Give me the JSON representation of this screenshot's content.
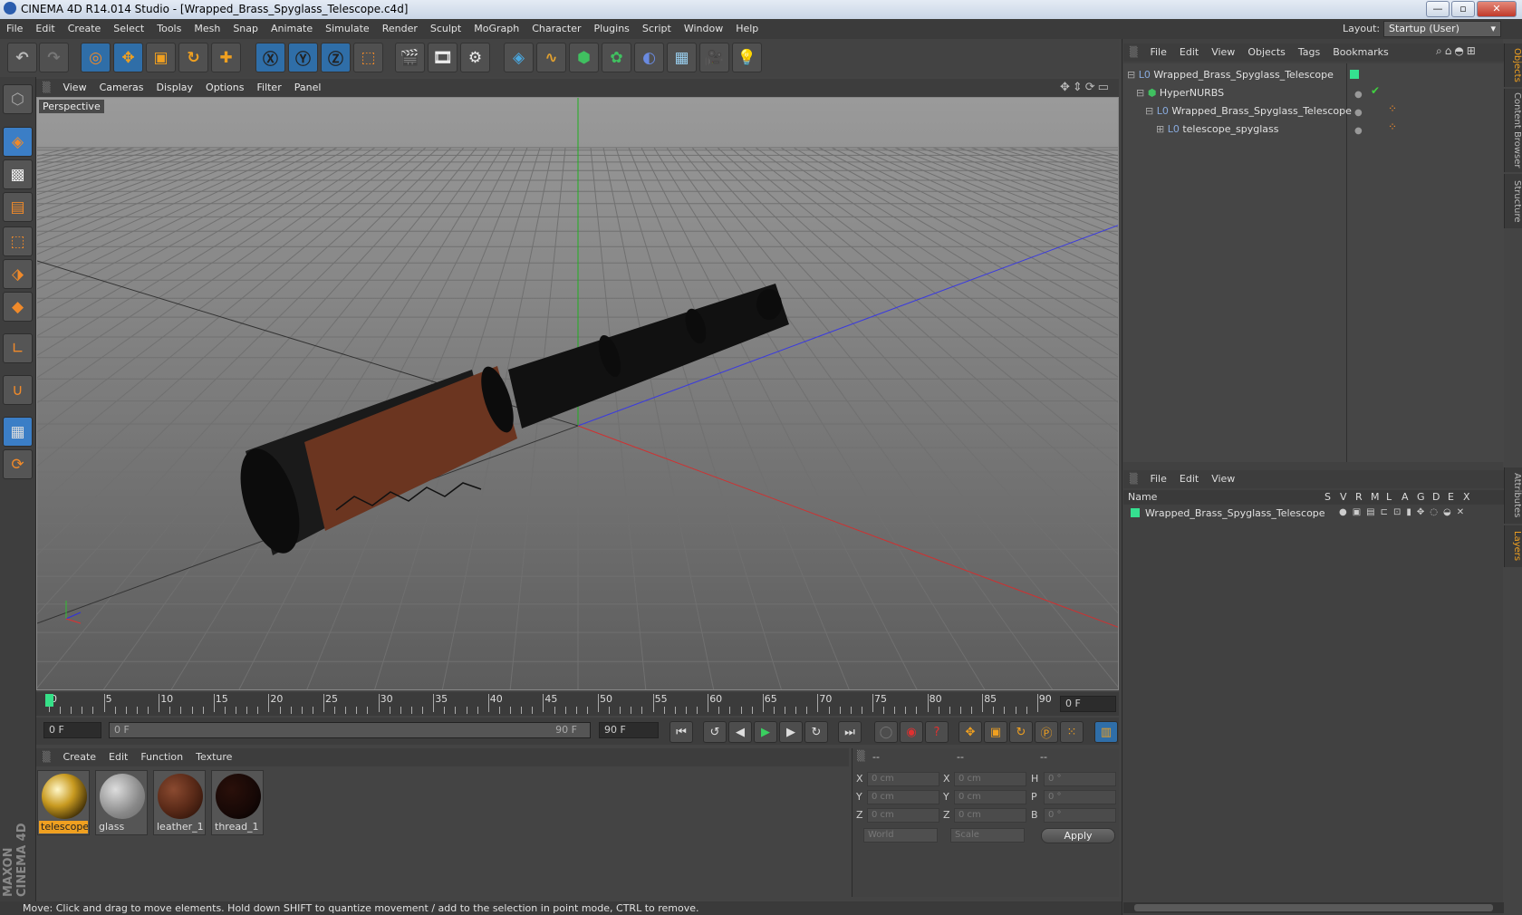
{
  "app": {
    "title": "CINEMA 4D R14.014 Studio - [Wrapped_Brass_Spyglass_Telescope.c4d]"
  },
  "window_controls": {
    "minimize": "—",
    "maximize": "▫",
    "close": "✕"
  },
  "menubar": [
    "File",
    "Edit",
    "Create",
    "Select",
    "Tools",
    "Mesh",
    "Snap",
    "Animate",
    "Simulate",
    "Render",
    "Sculpt",
    "MoGraph",
    "Character",
    "Plugins",
    "Script",
    "Window",
    "Help"
  ],
  "layout": {
    "label": "Layout:",
    "value": "Startup (User)"
  },
  "toolbar_icons": [
    "undo-icon",
    "redo-icon",
    "live-select-icon",
    "move-icon",
    "scale-icon",
    "rotate-icon",
    "create-add-icon",
    "x-axis-icon",
    "y-axis-icon",
    "z-axis-icon",
    "coordinate-system-icon",
    "render-view-icon",
    "render-picture-viewer-icon",
    "render-settings-icon",
    "cube-primitive-icon",
    "spline-pen-icon",
    "subdivision-nurbs-icon",
    "array-cloner-icon",
    "deformer-icon",
    "floor-icon",
    "camera-icon",
    "light-icon"
  ],
  "sidebar_icons": [
    "make-editable-icon",
    "model-mode-icon",
    "texture-mode-icon",
    "workplane-icon",
    "points-mode-icon",
    "edges-mode-icon",
    "polygons-mode-icon",
    "axis-mode-icon",
    "magnet-icon",
    "snap-grid-icon",
    "locked-workplane-icon"
  ],
  "viewport": {
    "menu": [
      "View",
      "Cameras",
      "Display",
      "Options",
      "Filter",
      "Panel"
    ],
    "label": "Perspective"
  },
  "timeline": {
    "ticks": [
      "0",
      "5",
      "10",
      "15",
      "20",
      "25",
      "30",
      "35",
      "40",
      "45",
      "50",
      "55",
      "60",
      "65",
      "70",
      "75",
      "80",
      "85",
      "90"
    ],
    "current_frame": "0 F"
  },
  "controls": {
    "start_field": "0 F",
    "range_start": "0 F",
    "range_end": "90 F",
    "end_field": "90 F"
  },
  "materials": {
    "menu": [
      "Create",
      "Edit",
      "Function",
      "Texture"
    ],
    "items": [
      {
        "name": "telescope_",
        "color": "#b8901f",
        "selected": true
      },
      {
        "name": "glass",
        "color": "#9a9a9a",
        "selected": false
      },
      {
        "name": "leather_1",
        "color": "#5a2a18",
        "selected": false
      },
      {
        "name": "thread_1",
        "color": "#160806",
        "selected": false
      }
    ]
  },
  "coordinates": {
    "header": [
      "--",
      "--",
      "--"
    ],
    "rows": [
      {
        "a": "X",
        "av": "0 cm",
        "b": "X",
        "bv": "0 cm",
        "c": "H",
        "cv": "0 °"
      },
      {
        "a": "Y",
        "av": "0 cm",
        "b": "Y",
        "bv": "0 cm",
        "c": "P",
        "cv": "0 °"
      },
      {
        "a": "Z",
        "av": "0 cm",
        "b": "Z",
        "bv": "0 cm",
        "c": "B",
        "cv": "0 °"
      }
    ],
    "world": "World",
    "scale": "Scale",
    "apply": "Apply"
  },
  "status": "Move: Click and drag to move elements. Hold down SHIFT to quantize movement / add to the selection in point mode, CTRL to remove.",
  "objects_panel": {
    "menu": [
      "File",
      "Edit",
      "View",
      "Objects",
      "Tags",
      "Bookmarks"
    ],
    "items": [
      {
        "name": "Wrapped_Brass_Spyglass_Telescope",
        "indent": 0
      },
      {
        "name": "HyperNURBS",
        "indent": 1
      },
      {
        "name": "Wrapped_Brass_Spyglass_Telescope",
        "indent": 2
      },
      {
        "name": "telescope_spyglass",
        "indent": 3
      }
    ]
  },
  "layers_panel": {
    "menu": [
      "File",
      "Edit",
      "View"
    ],
    "header_name": "Name",
    "columns": [
      "S",
      "V",
      "R",
      "M",
      "L",
      "A",
      "G",
      "D",
      "E",
      "X"
    ],
    "items": [
      {
        "name": "Wrapped_Brass_Spyglass_Telescope",
        "color": "#35c98a"
      }
    ]
  },
  "right_tabs": [
    "Objects",
    "Content Browser",
    "Structure",
    "Attributes",
    "Layers"
  ],
  "brand": {
    "logo": "MAXON CINEMA 4D"
  }
}
